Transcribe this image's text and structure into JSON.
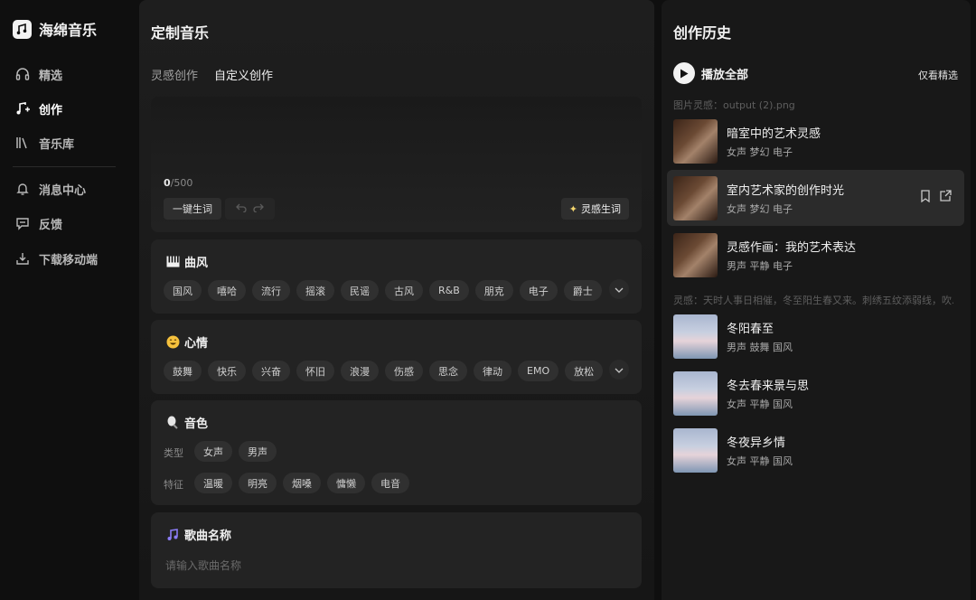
{
  "app": {
    "name": "海绵音乐"
  },
  "sidebar": {
    "items": [
      {
        "label": "精选",
        "icon": "headphones-icon"
      },
      {
        "label": "创作",
        "icon": "music-note-plus-icon"
      },
      {
        "label": "音乐库",
        "icon": "library-icon"
      },
      {
        "label": "消息中心",
        "icon": "bell-icon"
      },
      {
        "label": "反馈",
        "icon": "feedback-icon"
      },
      {
        "label": "下载移动端",
        "icon": "download-icon"
      }
    ],
    "active": "创作"
  },
  "create": {
    "title": "定制音乐",
    "tabs": [
      "灵感创作",
      "自定义创作"
    ],
    "active_tab": "自定义创作",
    "lyrics": {
      "count": "0",
      "max": "/500",
      "generate_label": "一键生词",
      "inspire_label": "灵感生词"
    },
    "style": {
      "title": "曲风",
      "chips": [
        "国风",
        "嘻哈",
        "流行",
        "摇滚",
        "民谣",
        "古风",
        "R&B",
        "朋克",
        "电子",
        "爵士"
      ]
    },
    "mood": {
      "title": "心情",
      "chips": [
        "鼓舞",
        "快乐",
        "兴奋",
        "怀旧",
        "浪漫",
        "伤感",
        "思念",
        "律动",
        "EMO",
        "放松"
      ]
    },
    "voice": {
      "title": "音色",
      "type_label": "类型",
      "types": [
        "女声",
        "男声"
      ],
      "feature_label": "特征",
      "features": [
        "温暖",
        "明亮",
        "烟嗓",
        "慵懒",
        "电音"
      ]
    },
    "song_name": {
      "title": "歌曲名称",
      "placeholder": "请输入歌曲名称"
    }
  },
  "history": {
    "title": "创作历史",
    "play_all": "播放全部",
    "only_featured": "仅看精选",
    "groups": [
      {
        "label": "图片灵感：output (2).png",
        "tracks": [
          {
            "title": "暗室中的艺术灵感",
            "tags": "女声 梦幻 电子"
          },
          {
            "title": "室内艺术家的创作时光",
            "tags": "女声 梦幻 电子"
          },
          {
            "title": "灵感作画：我的艺术表达",
            "tags": "男声 平静 电子"
          }
        ]
      },
      {
        "label": "灵感：天时人事日相催，冬至阳生春又来。刺绣五纹添弱线，吹...",
        "tracks": [
          {
            "title": "冬阳春至",
            "tags": "男声 鼓舞 国风"
          },
          {
            "title": "冬去春来景与思",
            "tags": "女声 平静 国风"
          },
          {
            "title": "冬夜异乡情",
            "tags": "女声 平静 国风"
          }
        ]
      }
    ]
  }
}
